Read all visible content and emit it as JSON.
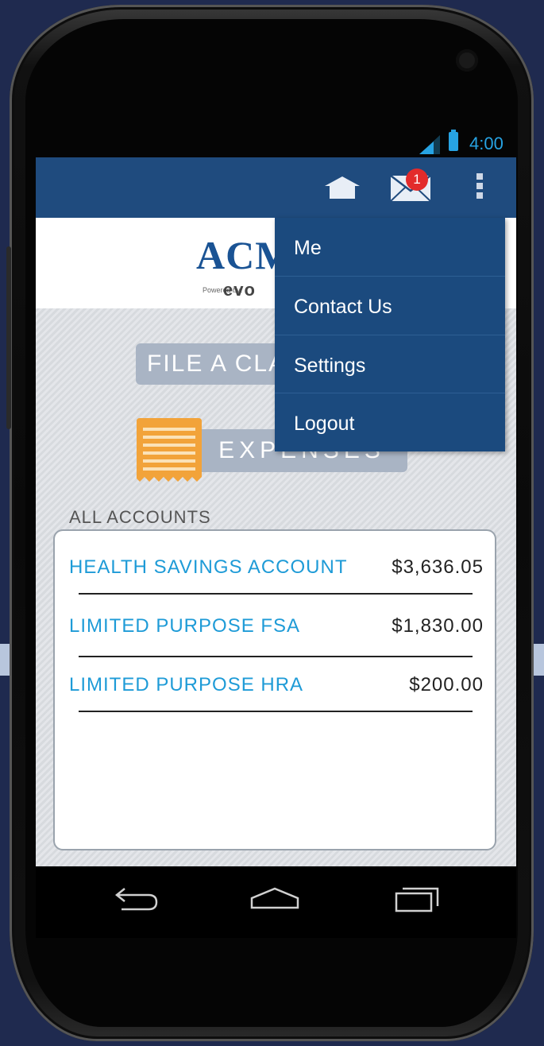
{
  "status_bar": {
    "time": "4:00"
  },
  "action_bar": {
    "icons": [
      "home-icon",
      "mail-icon",
      "overflow-menu-icon"
    ],
    "mail_badge_count": "1"
  },
  "logo": {
    "text": "ACM",
    "powered_by": "Powered by:",
    "brand": "evo"
  },
  "buttons": {
    "file_claim": "FILE A CLA",
    "expenses": "EXPENSES"
  },
  "accounts": {
    "section_title": "ALL ACCOUNTS",
    "items": [
      {
        "name": "HEALTH SAVINGS ACCOUNT",
        "balance": "$3,636.05"
      },
      {
        "name": "LIMITED PURPOSE FSA",
        "balance": "$1,830.00"
      },
      {
        "name": "LIMITED PURPOSE HRA",
        "balance": "$200.00"
      }
    ]
  },
  "menu": {
    "items": [
      {
        "label": "Me"
      },
      {
        "label": "Contact Us"
      },
      {
        "label": "Settings"
      },
      {
        "label": "Logout"
      }
    ]
  },
  "nav_bar": {
    "icons": [
      "back-icon",
      "home-nav-icon",
      "recent-apps-icon"
    ]
  },
  "colors": {
    "action_bar": "#1f4b7e",
    "menu_bg": "#1b4a7e",
    "account_link": "#1e9bd7",
    "badge": "#e32b2b",
    "receipt": "#f2a33a"
  }
}
